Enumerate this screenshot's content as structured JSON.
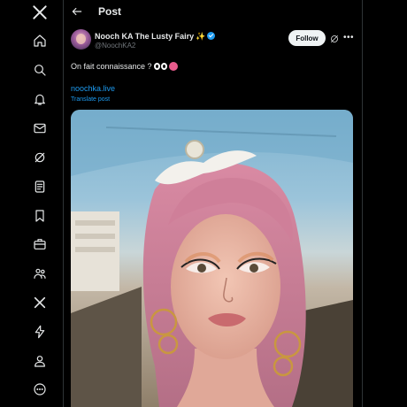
{
  "sidebar": {
    "items": [
      {
        "name": "x-logo-icon"
      },
      {
        "name": "home-icon"
      },
      {
        "name": "search-icon"
      },
      {
        "name": "notifications-icon"
      },
      {
        "name": "messages-icon"
      },
      {
        "name": "grok-icon"
      },
      {
        "name": "lists-icon"
      },
      {
        "name": "bookmarks-icon"
      },
      {
        "name": "jobs-icon"
      },
      {
        "name": "communities-icon"
      },
      {
        "name": "premium-icon"
      },
      {
        "name": "verified-orgs-icon"
      },
      {
        "name": "profile-icon"
      },
      {
        "name": "more-icon"
      }
    ]
  },
  "header": {
    "title": "Post"
  },
  "post": {
    "author": {
      "display_name": "Nooch KA The Lusty Fairy",
      "handle": "@NoochKA2",
      "verified": true
    },
    "follow_label": "Follow",
    "text": "On fait connaissance ?",
    "link": "noochka.live",
    "translate_label": "Translate post"
  },
  "colors": {
    "background": "#000000",
    "text": "#e7e9ea",
    "secondary": "#71767b",
    "accent": "#1d9bf0",
    "divider": "#2f3336"
  }
}
